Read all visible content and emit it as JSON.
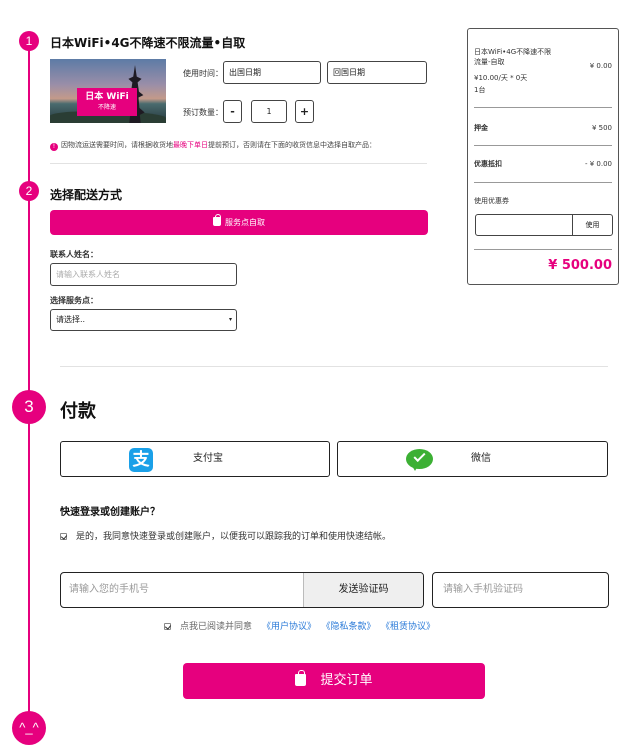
{
  "steps": [
    "1",
    "2",
    "3",
    "^_^"
  ],
  "product": {
    "title": "日本WiFi•4G不降速不限流量•自取",
    "image_text_line1": "日本 WiFi",
    "image_text_line2": "不降速",
    "use_time_label": "使用时间：",
    "depart_date": "出国日期",
    "return_date": "回国日期",
    "quantity_label": "预订数量：",
    "minus": "-",
    "quantity": "1",
    "plus": "+",
    "notice_pre": "因物流运送需要时间，请根据收货地",
    "notice_hl": "最晚下单日",
    "notice_post": "提前预订，否则请在下面的收货信息中选择自取产品："
  },
  "delivery": {
    "title": "选择配送方式",
    "option_label": "服务点自取",
    "contact_label": "联系人姓名：",
    "contact_placeholder": "请输入联系人姓名",
    "service_label": "选择服务点：",
    "service_value": "请选择..",
    "caret": "▾"
  },
  "summary": {
    "item_name": "日本WiFi•4G不降速不限流量-自取",
    "item_price": "¥ 0.00",
    "unit_line": "¥10.00/天 * 0天",
    "count_line": "1台",
    "deposit_label": "押金",
    "deposit_value": "¥ 500",
    "discount_label": "优惠抵扣",
    "discount_value": "- ¥ 0.00",
    "coupon_label": "使用优惠券",
    "coupon_button": "使用",
    "total": "¥ 500.00"
  },
  "payment": {
    "title": "付款",
    "alipay_icon": "支",
    "alipay_label": "支付宝",
    "wechat_label": "微信",
    "login_title": "快速登录或创建账户？",
    "login_consent": "是的，我同意快速登录或创建账户，以便我可以跟踪我的订单和使用快速结帐。",
    "phone_placeholder": "请输入您的手机号",
    "send_code": "发送验证码",
    "code_placeholder": "请输入手机验证码",
    "agree_text": "点我已阅读并同意",
    "agreement_user": "《用户协议》",
    "agreement_privacy": "《隐私条款》",
    "agreement_rental": "《租赁协议》",
    "submit": "提交订单"
  },
  "colors": {
    "accent": "#e6007e",
    "link": "#2a7ad8",
    "alipay": "#1aa0e8",
    "wechat": "#3cb034"
  }
}
